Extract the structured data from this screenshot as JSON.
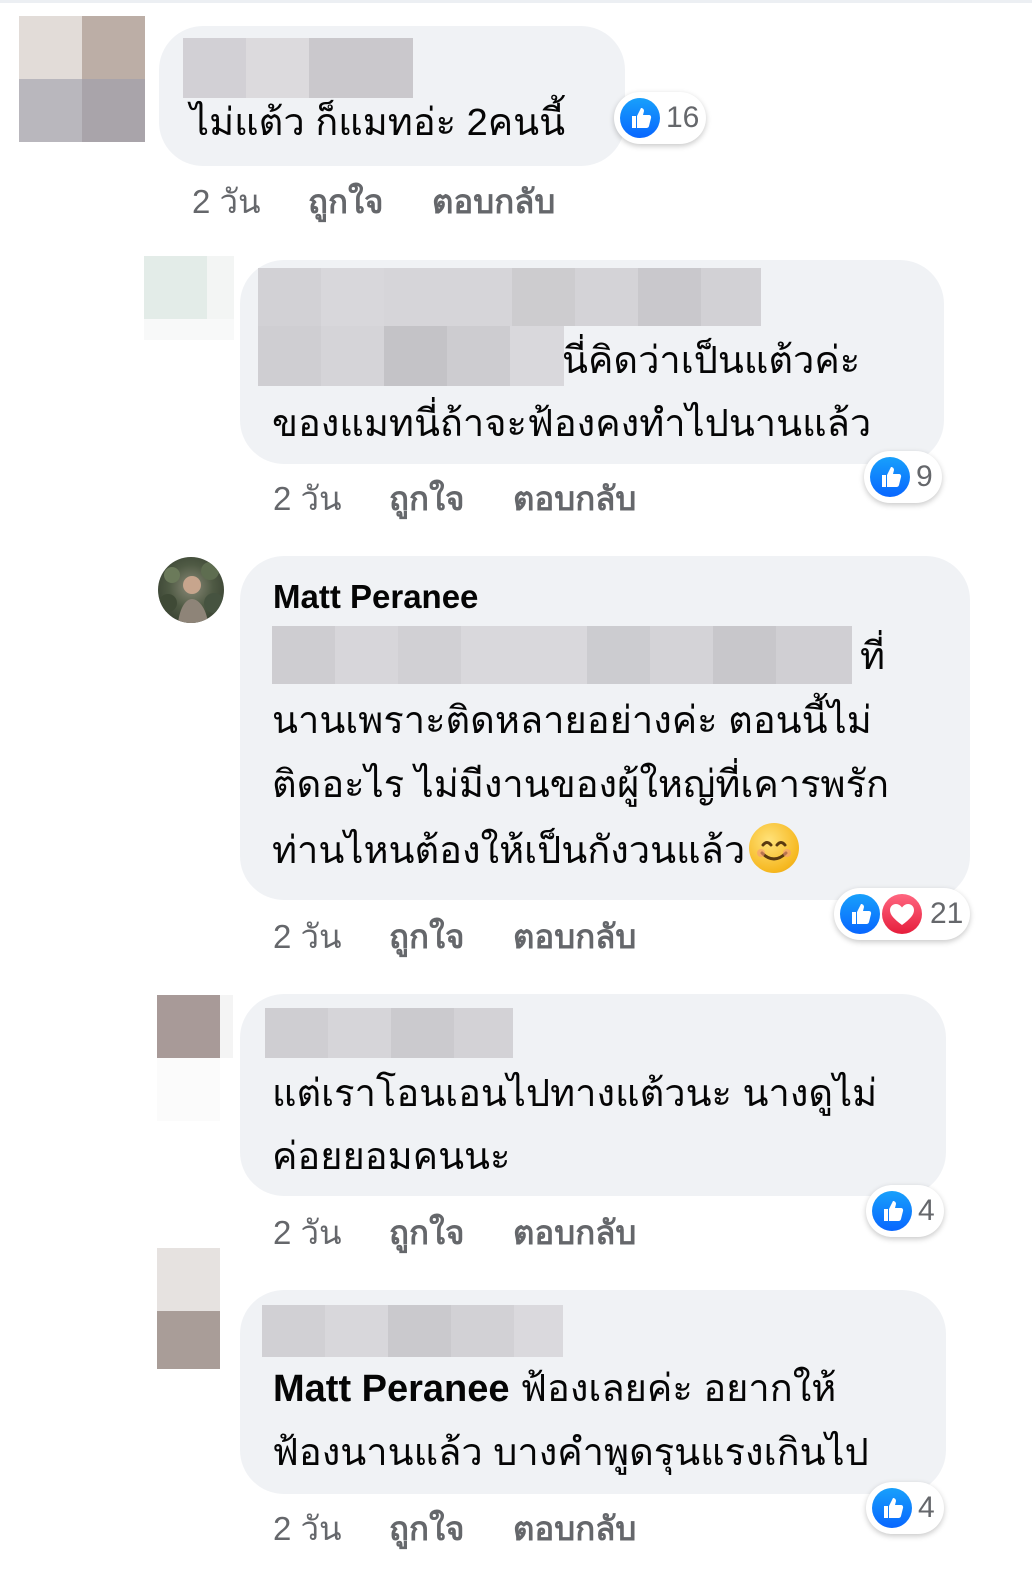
{
  "comments": [
    {
      "text_lines": [
        "ไม่แต้ว ก็แมทอ่ะ 2คนนี้"
      ],
      "time": "2 วัน",
      "like": "ถูกใจ",
      "reply": "ตอบกลับ",
      "reaction_count": "16"
    },
    {
      "text_lines": [
        "นี่คิดว่าเป็นแต้วค่ะ",
        "ของแมทนี่ถ้าจะฟ้องคงทำไปนานแล้ว"
      ],
      "time": "2 วัน",
      "like": "ถูกใจ",
      "reply": "ตอบกลับ",
      "reaction_count": "9"
    },
    {
      "author": "Matt Peranee",
      "text_lines": [
        "ที่",
        "นานเพราะติดหลายอย่างค่ะ ตอนนี้ไม่",
        "ติดอะไร ไม่มีงานของผู้ใหญ่ที่เคารพรัก",
        "ท่านไหนต้องให้เป็นกังวนแล้ว"
      ],
      "emoji": "smiling-face-icon",
      "time": "2 วัน",
      "like": "ถูกใจ",
      "reply": "ตอบกลับ",
      "reaction_count": "21"
    },
    {
      "text_lines": [
        "แต่เราโอนเอนไปทางแต้วนะ นางดูไม่",
        "ค่อยยอมคนนะ"
      ],
      "time": "2 วัน",
      "like": "ถูกใจ",
      "reply": "ตอบกลับ",
      "reaction_count": "4"
    },
    {
      "mention": "Matt Peranee",
      "text_lines": [
        " ฟ้องเลยค่ะ อยากให้",
        "ฟ้องนานแล้ว บางคำพูดรุนแรงเกินไป"
      ],
      "time": "2 วัน",
      "like": "ถูกใจ",
      "reply": "ตอบกลับ",
      "reaction_count": "4"
    }
  ],
  "colors": {
    "bubble": "#f0f2f5",
    "action_text": "#65676b",
    "like_blue": "#0866ff",
    "love_red": "#e61e3c"
  }
}
